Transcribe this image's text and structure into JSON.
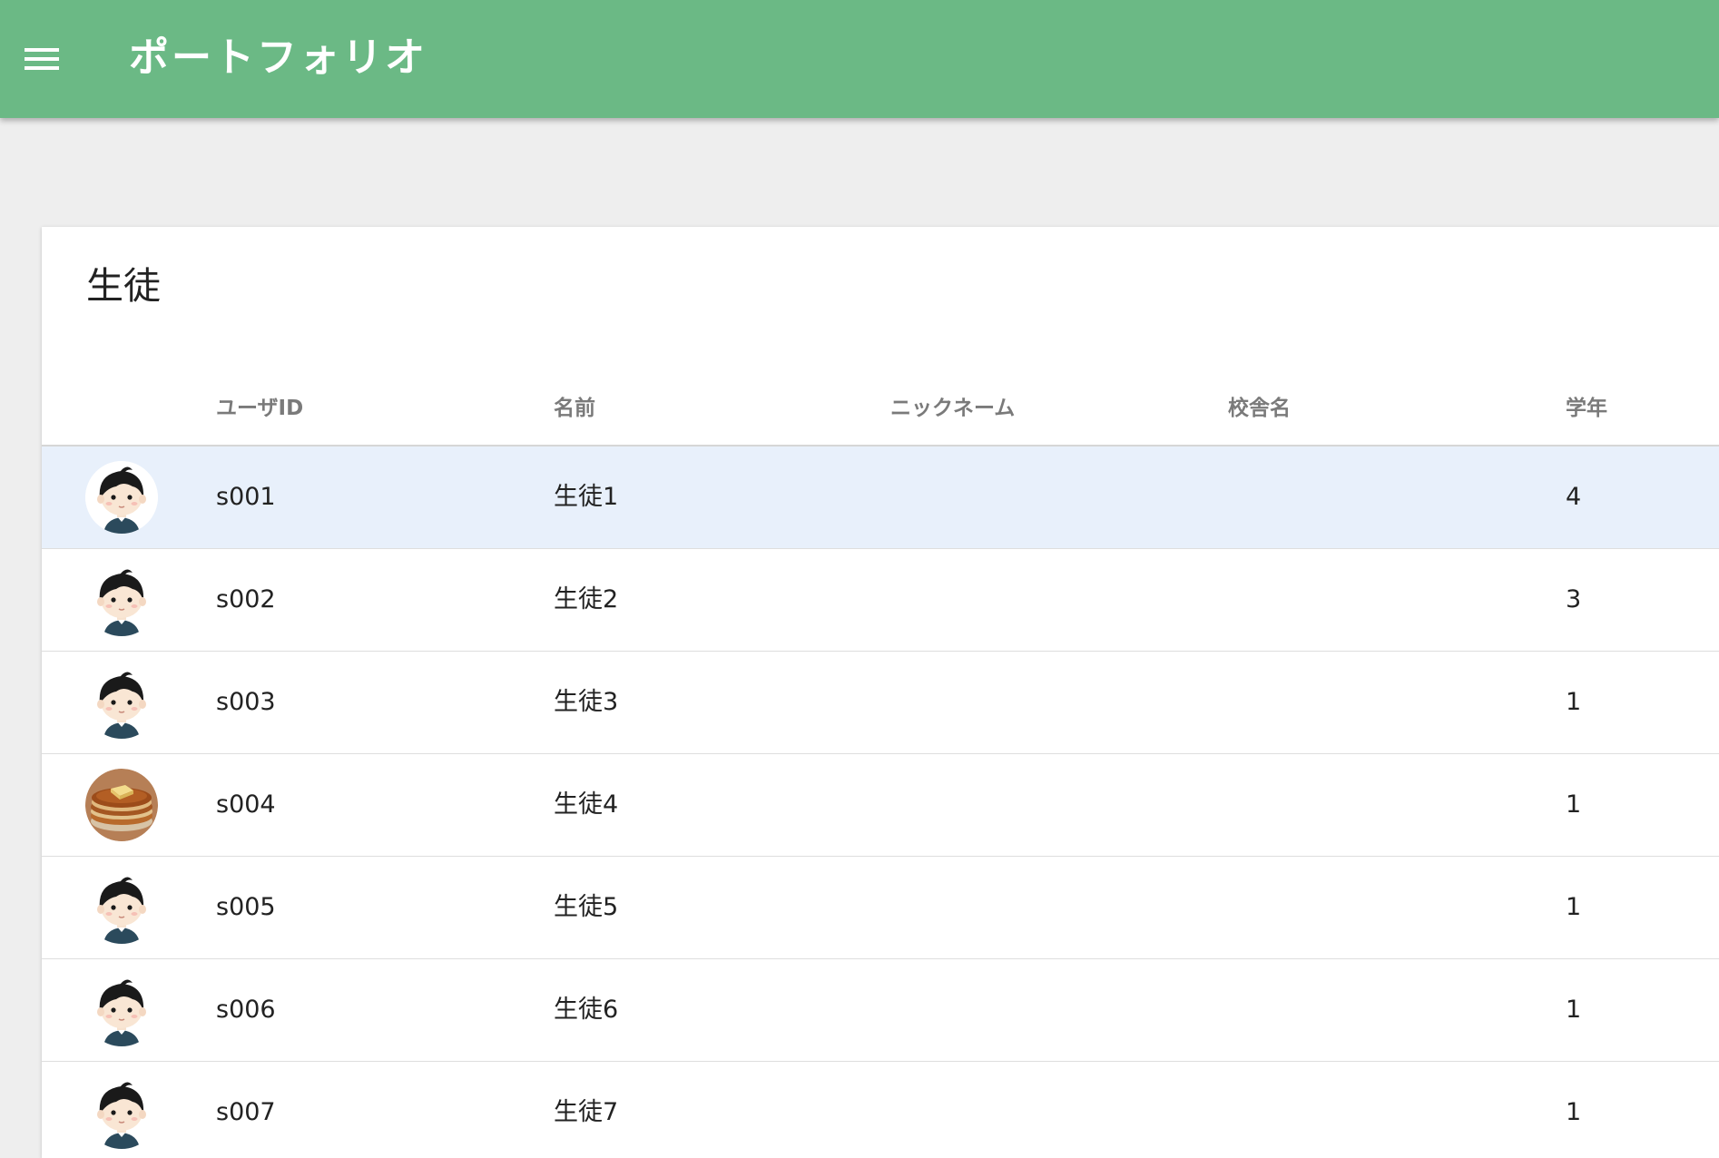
{
  "theme": {
    "accent": "#6bb985",
    "selected_row_bg": "#e8f0fb"
  },
  "appbar": {
    "title": "ポートフォリオ",
    "menu_icon": "menu-icon"
  },
  "card": {
    "title": "生徒",
    "columns": [
      "",
      "ユーザID",
      "名前",
      "ニックネーム",
      "校舎名",
      "学年"
    ]
  },
  "rows": [
    {
      "avatar": "boy-avatar",
      "user_id": "s001",
      "name": "生徒1",
      "nickname": "",
      "campus": "",
      "grade": "4",
      "selected": true
    },
    {
      "avatar": "boy-avatar",
      "user_id": "s002",
      "name": "生徒2",
      "nickname": "",
      "campus": "",
      "grade": "3"
    },
    {
      "avatar": "boy-avatar",
      "user_id": "s003",
      "name": "生徒3",
      "nickname": "",
      "campus": "",
      "grade": "1"
    },
    {
      "avatar": "pancake-avatar",
      "user_id": "s004",
      "name": "生徒4",
      "nickname": "",
      "campus": "",
      "grade": "1"
    },
    {
      "avatar": "boy-avatar",
      "user_id": "s005",
      "name": "生徒5",
      "nickname": "",
      "campus": "",
      "grade": "1"
    },
    {
      "avatar": "boy-avatar",
      "user_id": "s006",
      "name": "生徒6",
      "nickname": "",
      "campus": "",
      "grade": "1"
    },
    {
      "avatar": "boy-avatar",
      "user_id": "s007",
      "name": "生徒7",
      "nickname": "",
      "campus": "",
      "grade": "1"
    }
  ]
}
